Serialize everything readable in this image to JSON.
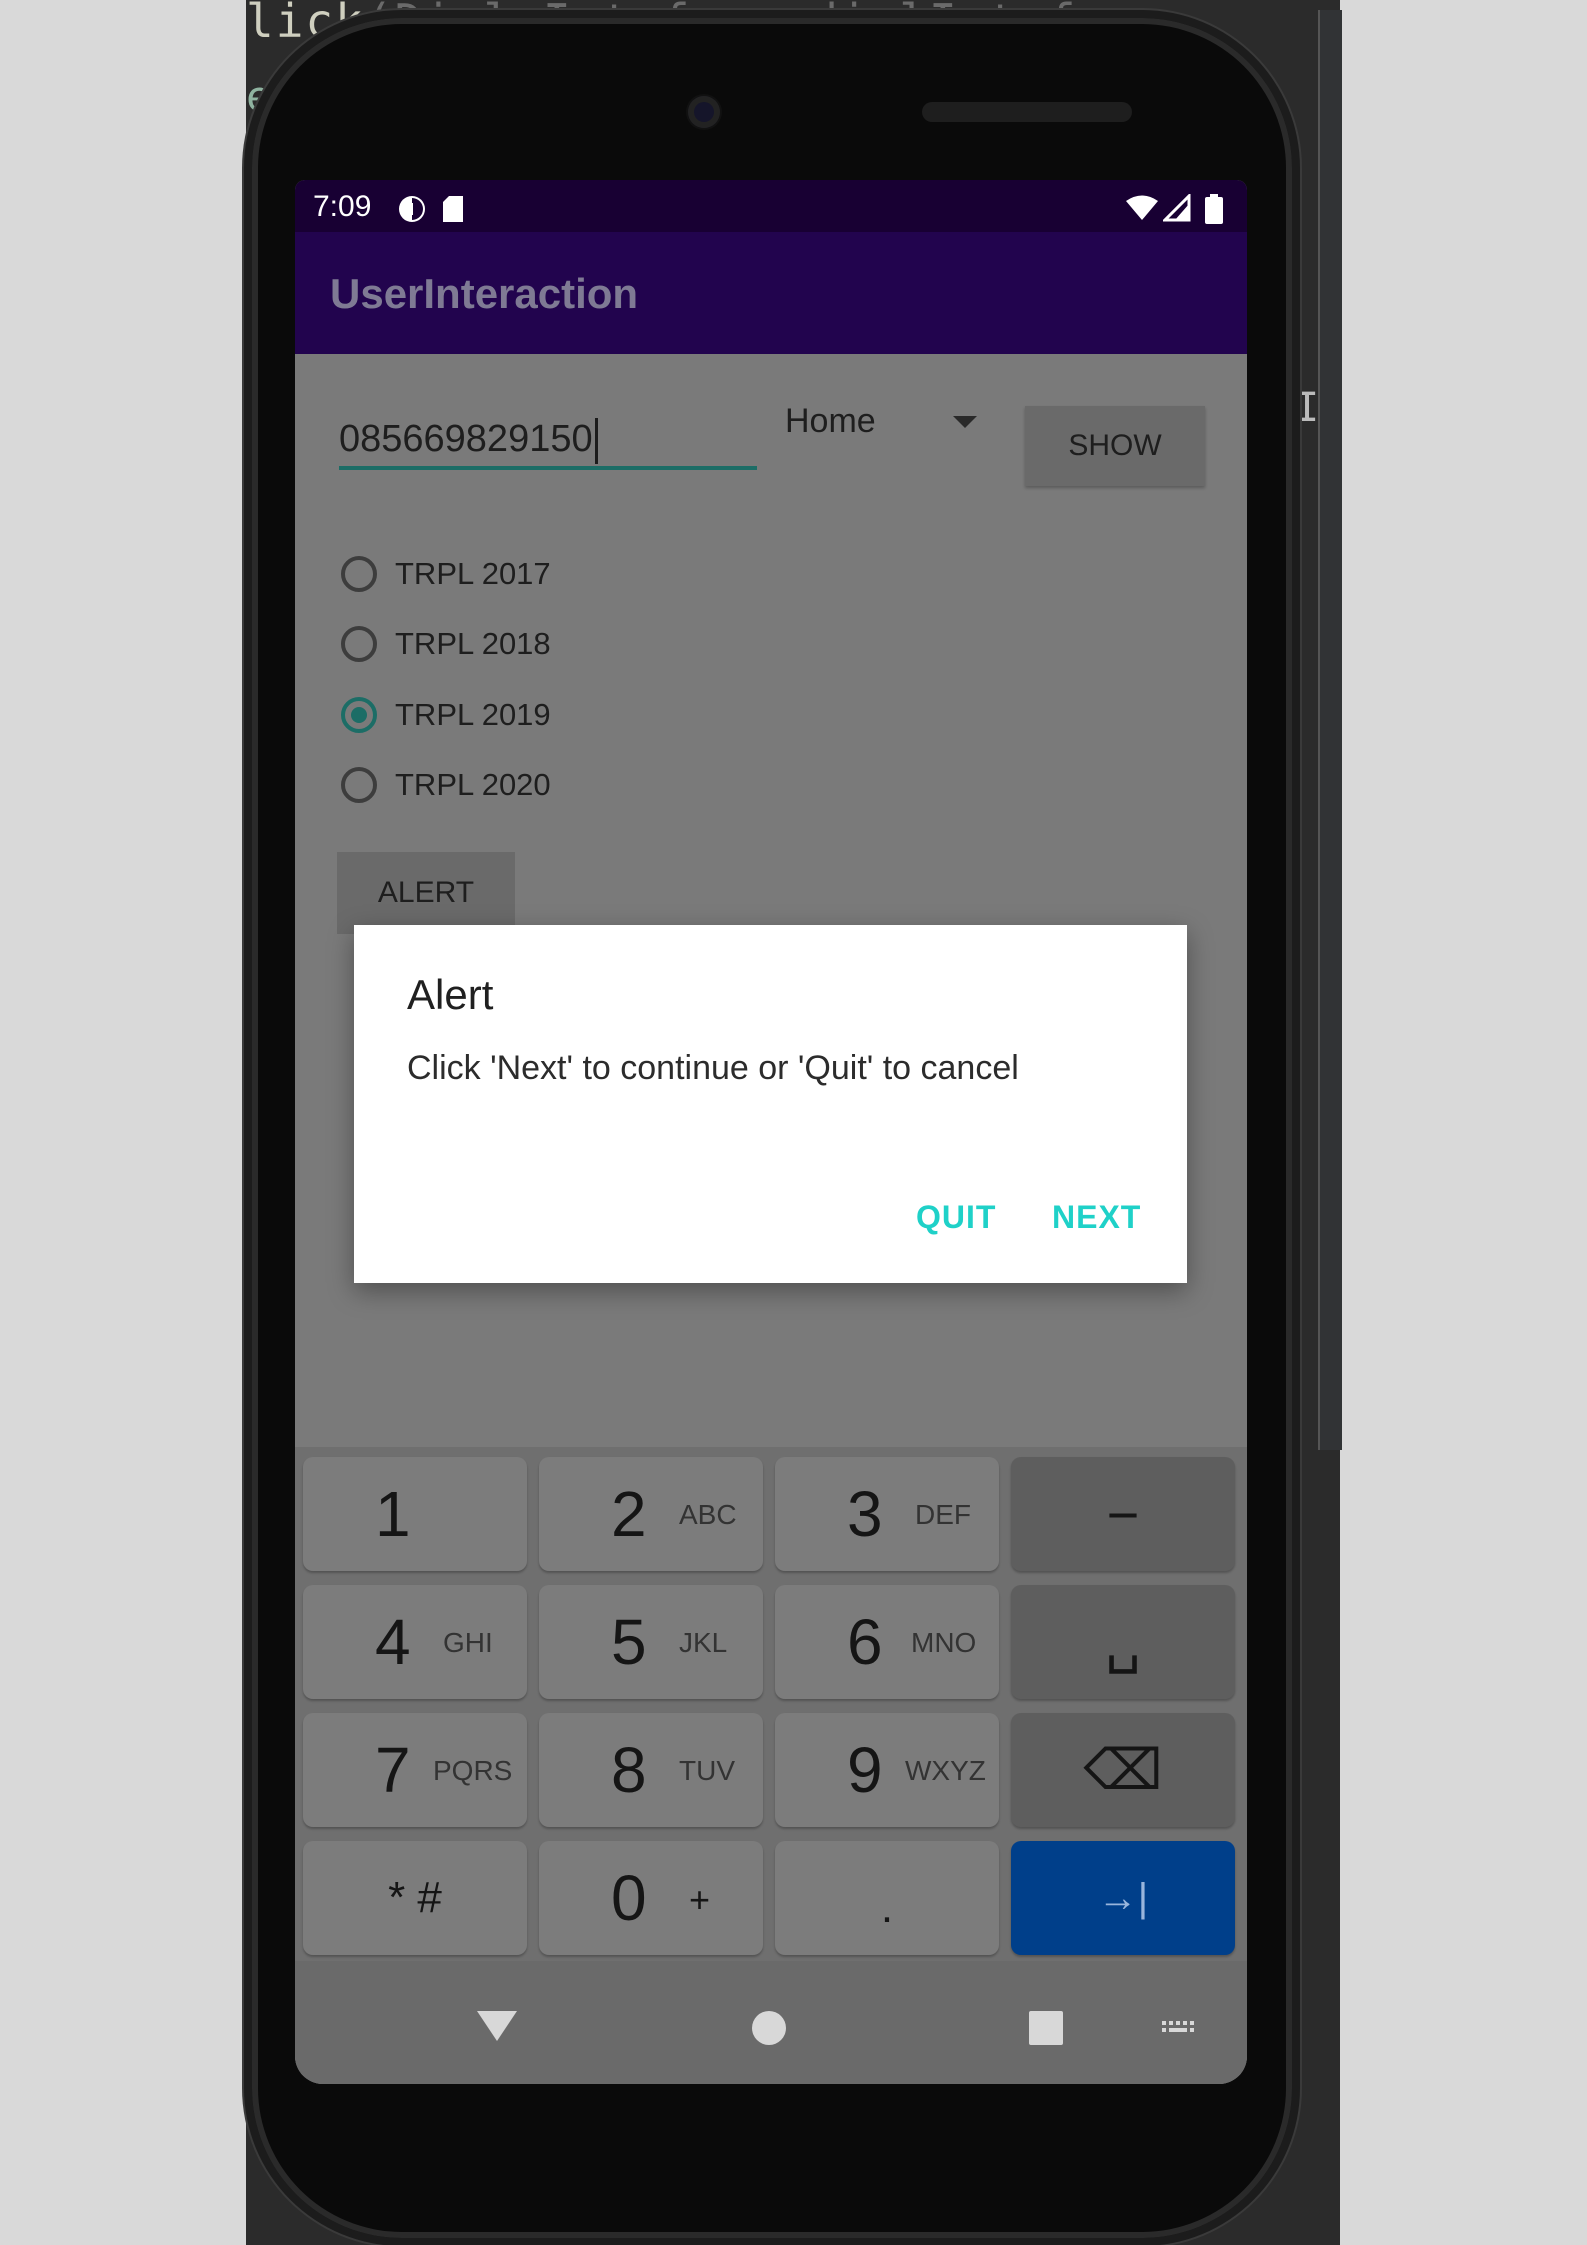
{
  "ide": {
    "code_line_1": "lick",
    "code_line_1_faded": "(Dial.Intrface dialIntrface,",
    "code_line_2": "e",
    "cursor_glyph": "I"
  },
  "status_bar": {
    "time": "7:09",
    "left_icons": [
      "data-saver-icon",
      "sd-card-icon"
    ],
    "right_icons": [
      "wifi-icon",
      "signal-icon",
      "battery-icon"
    ]
  },
  "app_bar": {
    "title": "UserInteraction",
    "color": "#22044e"
  },
  "form": {
    "phone_value": "085669829150",
    "spinner_value": "Home",
    "show_label": "SHOW",
    "radios": [
      {
        "label": "TRPL 2017",
        "checked": false
      },
      {
        "label": "TRPL 2018",
        "checked": false
      },
      {
        "label": "TRPL 2019",
        "checked": true
      },
      {
        "label": "TRPL 2020",
        "checked": false
      }
    ],
    "alert_label": "ALERT"
  },
  "dialog": {
    "title": "Alert",
    "message": "Click 'Next' to continue or 'Quit' to cancel",
    "quit_label": "QUIT",
    "next_label": "NEXT",
    "accent": "#1fd1c8"
  },
  "keyboard": {
    "keys": [
      {
        "main": "1",
        "sub": ""
      },
      {
        "main": "2",
        "sub": "ABC"
      },
      {
        "main": "3",
        "sub": "DEF"
      },
      {
        "main": "−",
        "sub": ""
      },
      {
        "main": "4",
        "sub": "GHI"
      },
      {
        "main": "5",
        "sub": "JKL"
      },
      {
        "main": "6",
        "sub": "MNO"
      },
      {
        "main": "␣",
        "sub": ""
      },
      {
        "main": "7",
        "sub": "PQRS"
      },
      {
        "main": "8",
        "sub": "TUV"
      },
      {
        "main": "9",
        "sub": "WXYZ"
      },
      {
        "main": "⌫",
        "sub": ""
      },
      {
        "main": "* #",
        "sub": ""
      },
      {
        "main": "0",
        "sub": "+"
      },
      {
        "main": ".",
        "sub": ""
      },
      {
        "main": "→|",
        "sub": ""
      }
    ],
    "enter_color": "#003f8a"
  },
  "nav_bar": {
    "icons": [
      "back-icon",
      "home-icon",
      "recents-icon",
      "keyboard-switch-icon"
    ]
  }
}
